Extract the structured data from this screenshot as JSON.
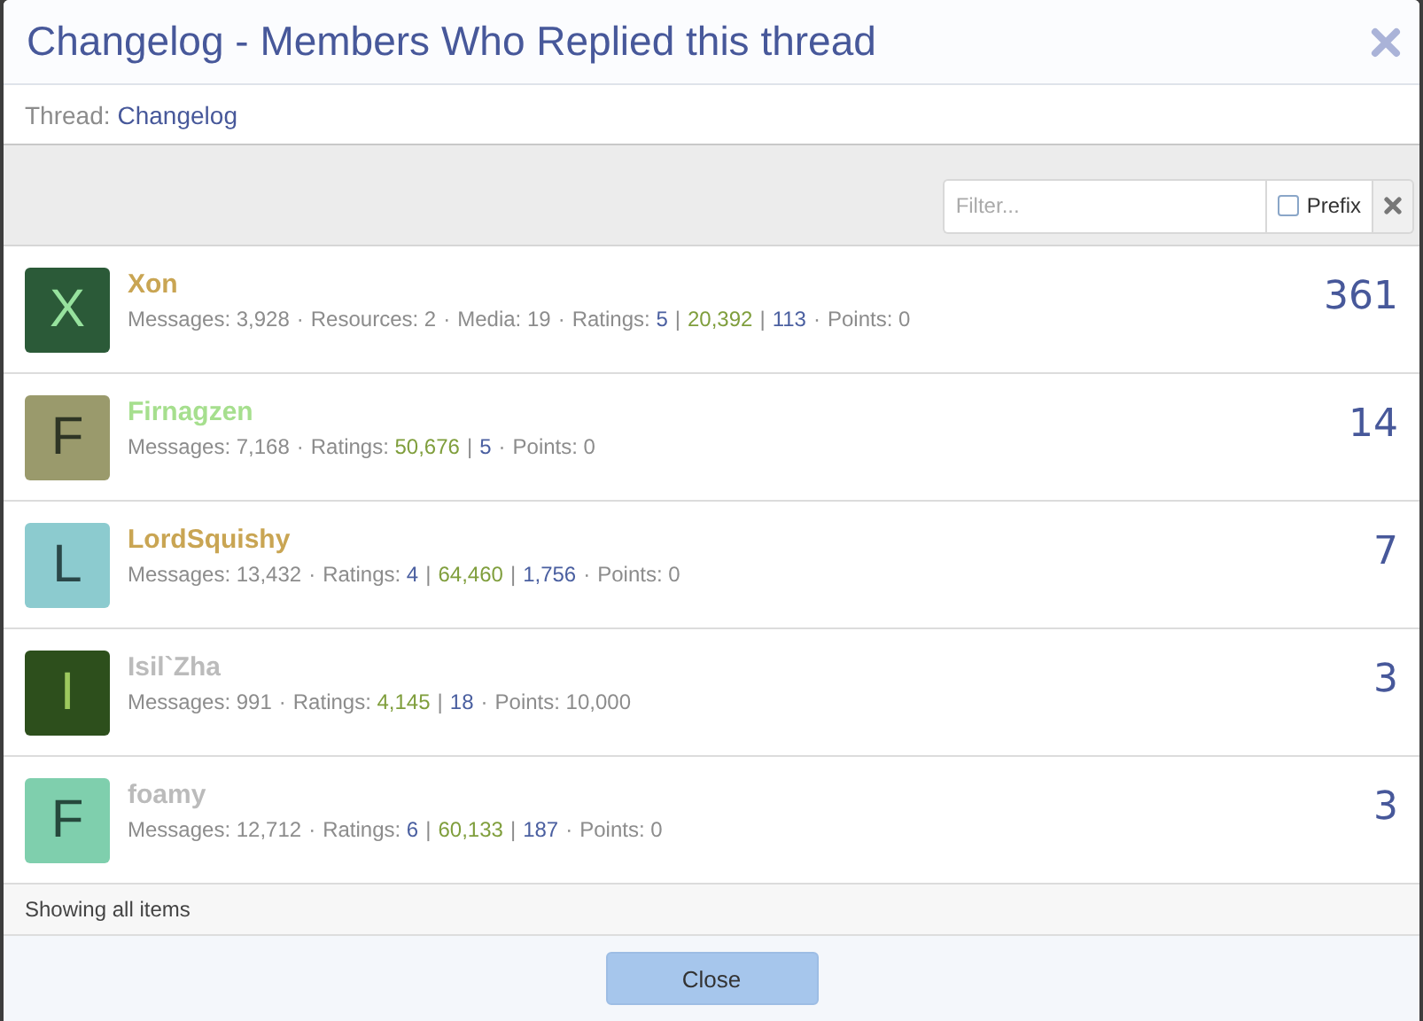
{
  "dialog": {
    "title": "Changelog - Members Who Replied this thread",
    "thread_label": "Thread:",
    "thread_link": "Changelog"
  },
  "filter": {
    "placeholder": "Filter...",
    "prefix_label": "Prefix",
    "prefix_checked": false
  },
  "members": [
    {
      "avatar": {
        "letter": "X",
        "color": "#2b5a38"
      },
      "name": {
        "text": "Xon",
        "color": "#c9a553"
      },
      "count": "361",
      "stat_separator": "·",
      "stats": [
        {
          "label": "Messages:",
          "value": "3,928"
        },
        {
          "label": "Resources:",
          "value": "2"
        },
        {
          "label": "Media:",
          "value": "19"
        },
        {
          "label": "Ratings:",
          "separator": "|",
          "ratings": [
            {
              "value": "5",
              "color": "#4a5fa0"
            },
            {
              "value": "20,392",
              "color": "#7f9e3c"
            },
            {
              "value": "113",
              "color": "#4a5fa0"
            }
          ]
        },
        {
          "label": "Points:",
          "value": "0"
        }
      ]
    },
    {
      "avatar": {
        "letter": "F",
        "color": "#9a9a6c"
      },
      "name": {
        "text": "Firnagzen",
        "color": "#a6df8e"
      },
      "count": "14",
      "stat_separator": "·",
      "stats": [
        {
          "label": "Messages:",
          "value": "7,168"
        },
        {
          "label": "Ratings:",
          "separator": "|",
          "ratings": [
            {
              "value": "50,676",
              "color": "#7f9e3c"
            },
            {
              "value": "5",
              "color": "#4a5fa0"
            }
          ]
        },
        {
          "label": "Points:",
          "value": "0"
        }
      ]
    },
    {
      "avatar": {
        "letter": "L",
        "color": "#8ccbcf"
      },
      "name": {
        "text": "LordSquishy",
        "color": "#c9a553"
      },
      "count": "7",
      "stat_separator": "·",
      "stats": [
        {
          "label": "Messages:",
          "value": "13,432"
        },
        {
          "label": "Ratings:",
          "separator": "|",
          "ratings": [
            {
              "value": "4",
              "color": "#4a5fa0"
            },
            {
              "value": "64,460",
              "color": "#7f9e3c"
            },
            {
              "value": "1,756",
              "color": "#4a5fa0"
            }
          ]
        },
        {
          "label": "Points:",
          "value": "0"
        }
      ]
    },
    {
      "avatar": {
        "letter": "I",
        "color": "#2d4f1c"
      },
      "name": {
        "text": "Isil`Zha",
        "color": "#bbbbbb"
      },
      "count": "3",
      "stat_separator": "·",
      "stats": [
        {
          "label": "Messages:",
          "value": "991"
        },
        {
          "label": "Ratings:",
          "separator": "|",
          "ratings": [
            {
              "value": "4,145",
              "color": "#7f9e3c"
            },
            {
              "value": "18",
              "color": "#4a5fa0"
            }
          ]
        },
        {
          "label": "Points:",
          "value": "10,000"
        }
      ]
    },
    {
      "avatar": {
        "letter": "F",
        "color": "#7fcfad"
      },
      "name": {
        "text": "foamy",
        "color": "#bbbbbb"
      },
      "count": "3",
      "stat_separator": "·",
      "stats": [
        {
          "label": "Messages:",
          "value": "12,712"
        },
        {
          "label": "Ratings:",
          "separator": "|",
          "ratings": [
            {
              "value": "6",
              "color": "#4a5fa0"
            },
            {
              "value": "60,133",
              "color": "#7f9e3c"
            },
            {
              "value": "187",
              "color": "#4a5fa0"
            }
          ]
        },
        {
          "label": "Points:",
          "value": "0"
        }
      ]
    }
  ],
  "footer": {
    "status": "Showing all items"
  },
  "buttons": [
    {
      "label": "Close"
    }
  ]
}
